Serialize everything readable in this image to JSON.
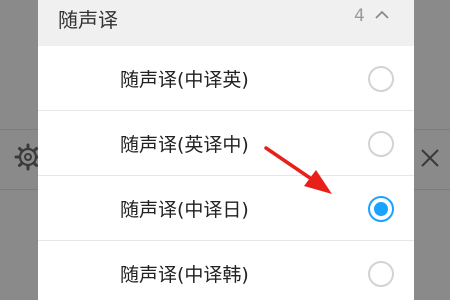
{
  "header": {
    "title": "随声译",
    "count": "4",
    "chevron_icon": "chevron-up-icon"
  },
  "options": [
    {
      "label": "随声译(中译英)",
      "selected": false
    },
    {
      "label": "随声译(英译中)",
      "selected": false
    },
    {
      "label": "随声译(中译日)",
      "selected": true
    },
    {
      "label": "随声译(中译韩)",
      "selected": false
    }
  ],
  "background_icons": {
    "left": "gear-icon",
    "right": "close-icon"
  },
  "colors": {
    "accent": "#1aa3ff",
    "annotation_arrow": "#e8201a",
    "overlay": "#8a8a8a"
  }
}
